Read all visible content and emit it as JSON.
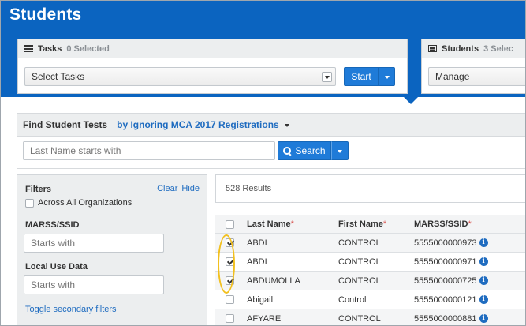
{
  "page": {
    "title": "Students"
  },
  "tasks_card": {
    "title": "Tasks",
    "selected_text": "0 Selected",
    "select_value": "Select Tasks",
    "start_label": "Start"
  },
  "students_card": {
    "title": "Students",
    "selected_text": "3 Selec",
    "select_value": "Manage"
  },
  "find": {
    "label": "Find Student Tests",
    "mode": "by Ignoring MCA 2017 Registrations",
    "placeholder": "Last Name starts with",
    "search_label": "Search"
  },
  "filters": {
    "title": "Filters",
    "clear": "Clear",
    "hide": "Hide",
    "across_label": "Across All Organizations",
    "across_checked": false,
    "marss_label": "MARSS/SSID",
    "marss_placeholder": "Starts with",
    "local_label": "Local Use Data",
    "local_placeholder": "Starts with",
    "toggle": "Toggle secondary filters"
  },
  "results": {
    "count_text": "528 Results",
    "columns": {
      "last": "Last Name",
      "first": "First Name",
      "ssid": "MARSS/SSID",
      "required_mark": "*"
    },
    "rows": [
      {
        "checked": true,
        "last": "ABDI",
        "first": "CONTROL",
        "ssid": "5555000000973"
      },
      {
        "checked": true,
        "last": "ABDI",
        "first": "CONTROL",
        "ssid": "5555000000971"
      },
      {
        "checked": true,
        "last": "ABDUMOLLA",
        "first": "CONTROL",
        "ssid": "5555000000725"
      },
      {
        "checked": false,
        "last": "Abigail",
        "first": "Control",
        "ssid": "5555000000121"
      },
      {
        "checked": false,
        "last": "AFYARE",
        "first": "CONTROL",
        "ssid": "5555000000881"
      }
    ]
  },
  "colors": {
    "brand_blue": "#0b64c0",
    "button_blue": "#1f7bd8",
    "link_blue": "#1f6cc0",
    "highlight": "#f2c01e"
  }
}
